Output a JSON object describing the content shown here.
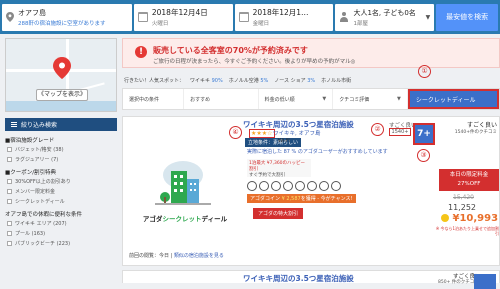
{
  "search": {
    "destination": "オアフ島",
    "destination_sub": "288軒の宿泊施設に空室があります",
    "checkin_date": "2018年12月4日",
    "checkin_day": "火曜日",
    "checkout_date": "2018年12月1…",
    "checkout_day": "金曜日",
    "guests": "大人1名, 子ども0名",
    "rooms": "1部屋",
    "button": "最安値を検索"
  },
  "sidebar": {
    "map_button": "《マップを表示》",
    "filter_head": "絞り込み検索",
    "groups": [
      {
        "title": "■宿泊施設グレード",
        "items": [
          "バジェット/格安 (38)",
          "ラグジュアリー (7)"
        ]
      },
      {
        "title": "■クーポン/割引特典",
        "items": [
          "30%OFF以上の割引あり",
          "メンバー限定料金",
          "シークレットディール"
        ]
      },
      {
        "title": "オアフ島での休暇に便利な条件",
        "items": [
          "ワイキキ エリア (207)",
          "プール (163)",
          "パブリックビーチ (223)"
        ]
      }
    ]
  },
  "banner": {
    "alert": "!",
    "title": "販売している全客室の70%が予約済みです",
    "subtitle": "ご旅行の日程が決まったら、今すぐご予約ください。後よりが早めの予約がマル◎"
  },
  "spots": [
    "行きたい！人気スポット：",
    "ワイキキ",
    "90%",
    "ホノルル空港",
    "5%",
    "ノース ショア",
    "3%",
    "ホノルル市街"
  ],
  "sort": {
    "items": [
      "選択中の条件",
      "おすすめ",
      "料金の低い順",
      "クチコミ評価",
      "シークレットディール"
    ]
  },
  "hotel": {
    "name": "ワイキキ周辺の3.5つ星宿泊施設",
    "stars": "★★★☆",
    "location": "ワイキキ, オアフ島",
    "badge_location": "立地条件：素晴らしい",
    "badge_wifi": "Wi-Fi",
    "note": "実際に宿泊した 87 % のアゴダユーザーがおすすめしています",
    "box_line1": "1泊最大 ¥7,360のハッピー割引",
    "box_line2": "すぐ予約で大割引",
    "coin": "アゴダコイン",
    "coin_value": "¥ 2,587",
    "coin_suffix": "を獲得 - 今がチャンス!",
    "deal_button": "アゴダの特大割引",
    "illustration_text_a": "アゴダ",
    "illustration_text_b": "シークレット",
    "illustration_text_c": "ディール",
    "rating_word": "すごく良い",
    "review_count": "1540+",
    "rating_sub": "件のクチコミ",
    "score": "7+",
    "price_good": "すごく良い",
    "price_sub": "1540+件のクチコミ",
    "today_deal": "本日の限定料金",
    "today_off": "27%OFF",
    "price_old": "15,420",
    "price_mid": "11,252",
    "price_final": "¥10,993",
    "price_note": "※ 今なら1泊あたり上乗せで追加割引",
    "recent_label": "前回の閲覧：今日 |",
    "recent_link": "類似の宿泊施設を見る"
  },
  "hotel2": {
    "name": "ワイキキ周辺の3.5つ星宿泊施設",
    "rating_word": "すごく良い",
    "sub": "850+ 件のクチコミ"
  },
  "markers": [
    "①",
    "②",
    "③",
    "④"
  ],
  "colors": {
    "header": "#2a7ab0",
    "search_button": "#5392f9",
    "accent_red": "#d32f2f",
    "link_blue": "#3a5fb6",
    "score_blue": "#3b6fc9",
    "price_orange": "#e86f2b"
  }
}
